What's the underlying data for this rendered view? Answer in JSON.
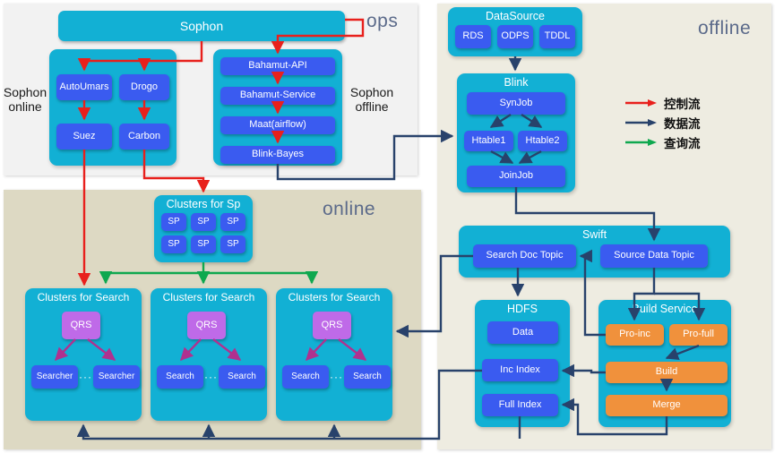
{
  "regions": {
    "ops": {
      "label": "ops"
    },
    "online": {
      "label": "online"
    },
    "offline": {
      "label": "offline"
    }
  },
  "side_labels": {
    "sophon_online": "Sophon\nonline",
    "sophon_online_l1": "Sophon",
    "sophon_online_l2": "online",
    "sophon_offline_l1": "Sophon",
    "sophon_offline_l2": "offline"
  },
  "ops_section": {
    "sophon_bar": "Sophon",
    "online_group": {
      "nodes": [
        "AutoUmars",
        "Drogo",
        "Suez",
        "Carbon"
      ]
    },
    "offline_group": {
      "nodes": [
        "Bahamut-API",
        "Bahamut-Service",
        "Maat(airflow)",
        "Blink-Bayes"
      ]
    }
  },
  "offline_section": {
    "datasource": {
      "title": "DataSource",
      "nodes": [
        "RDS",
        "ODPS",
        "TDDL"
      ]
    },
    "blink": {
      "title": "Blink",
      "nodes": [
        "SynJob",
        "Htable1",
        "Htable2",
        "JoinJob"
      ]
    },
    "swift": {
      "title": "Swift",
      "nodes": [
        "Search Doc Topic",
        "Source Data Topic"
      ]
    },
    "hdfs": {
      "title": "HDFS",
      "nodes": [
        "Data",
        "Inc Index",
        "Full Index"
      ]
    },
    "build_service": {
      "title": "Build Service",
      "nodes": [
        "Pro-inc",
        "Pro-full",
        "Build",
        "Merge"
      ]
    }
  },
  "online_section": {
    "clusters_for_sp": {
      "title": "Clusters for Sp",
      "nodes": [
        "SP",
        "SP",
        "SP",
        "SP",
        "SP",
        "SP"
      ]
    },
    "search_clusters": [
      {
        "title": "Clusters for Search",
        "qrs": "QRS",
        "left": "Searcher",
        "right": "Searcher",
        "ellipsis": "···"
      },
      {
        "title": "Clusters for Search",
        "qrs": "QRS",
        "left": "Search",
        "right": "Search",
        "ellipsis": "···"
      },
      {
        "title": "Clusters for Search",
        "qrs": "QRS",
        "left": "Search",
        "right": "Search",
        "ellipsis": "···"
      }
    ]
  },
  "legend": {
    "items": [
      {
        "label": "控制流",
        "color": "#e8201c"
      },
      {
        "label": "数据流",
        "color": "#28426b"
      },
      {
        "label": "查询流",
        "color": "#0fa84f"
      }
    ]
  },
  "colors": {
    "control_flow": "#e8201c",
    "data_flow": "#28426b",
    "query_flow": "#0fa84f",
    "group_fill": "#12b0d4",
    "node_fill": "#3a5bf0",
    "orange_fill": "#f0913c",
    "qrs_fill": "#bf6ae8",
    "qrs_arrow": "#b0318f",
    "ops_panel": "#f2f2f2",
    "online_panel": "#ddd9c3",
    "offline_panel": "#eeece1"
  }
}
